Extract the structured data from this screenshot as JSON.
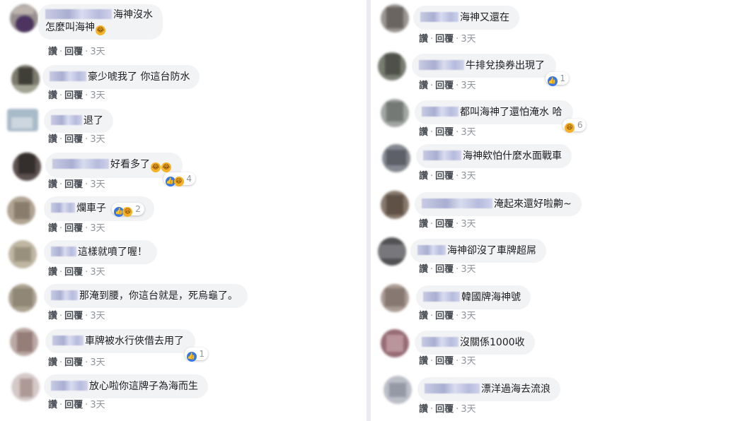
{
  "labels": {
    "like": "讚",
    "reply": "回覆",
    "dot": "·"
  },
  "left_comments": [
    {
      "text_line1": "海神沒水",
      "text_line2": "怎麼叫海神",
      "emoji_count": 1,
      "time": "3天",
      "reaction": null
    },
    {
      "text": "豪少唬我了 你這台防水",
      "time": "3天",
      "reaction": null
    },
    {
      "text": "退了",
      "time": "3天",
      "reaction": null
    },
    {
      "text": "好看多了",
      "emoji_count": 2,
      "time": "3天",
      "reaction": {
        "icons": [
          "like-icon",
          "haha-icon"
        ],
        "count": "4"
      }
    },
    {
      "text": "爛車子",
      "time": "3天",
      "reaction": {
        "icons": [
          "like-icon",
          "haha-icon"
        ],
        "count": "2",
        "inline": true
      }
    },
    {
      "text": "這樣就噴了喔！",
      "time": "3天",
      "reaction": null
    },
    {
      "text": "那淹到腰，你這台就是，死烏龜了。",
      "time": "3天",
      "reaction": null
    },
    {
      "text": "車牌被水行俠借去用了",
      "time": "3天",
      "reaction": {
        "icons": [
          "like-icon"
        ],
        "count": "1"
      }
    },
    {
      "text": "放心啦你這牌子為海而生",
      "time": "3天",
      "reaction": null
    }
  ],
  "right_comments": [
    {
      "text": "海神又還在",
      "time": "3天",
      "reaction": null
    },
    {
      "text": "牛排兌換券出現了",
      "time": "3天",
      "reaction": {
        "icons": [
          "like-icon"
        ],
        "count": "1"
      }
    },
    {
      "text": "都叫海神了還怕淹水 哈",
      "time": "3天",
      "reaction": {
        "icons": [
          "haha-icon"
        ],
        "count": "6"
      }
    },
    {
      "text": "海神欸怕什麼水面戰車",
      "time": "3天",
      "reaction": null
    },
    {
      "text": "淹起來還好啦齁~",
      "time": "3天",
      "reaction": null
    },
    {
      "text": "海神卻沒了車牌超屌",
      "time": "3天",
      "reaction": null
    },
    {
      "text": "韓國牌海神號",
      "time": "3天",
      "reaction": null
    },
    {
      "text": "沒關係1000收",
      "time": "3天",
      "reaction": null
    },
    {
      "text": "漂洋過海去流浪",
      "time": "3天",
      "reaction": null
    }
  ],
  "colors": {
    "like": "#3578e5",
    "haha": "#f7b125",
    "bubble": "#f2f3f5",
    "divider": "#e9ebee"
  }
}
